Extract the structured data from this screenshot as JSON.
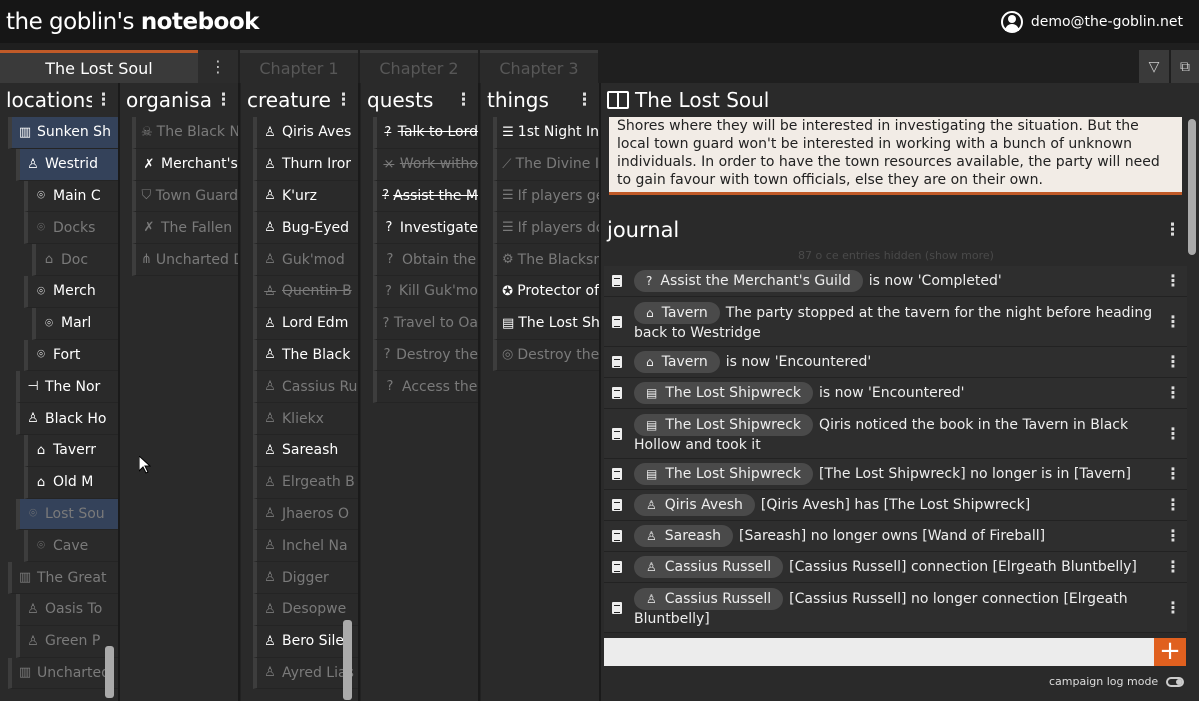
{
  "app": {
    "brand_prefix": "the goblin's ",
    "brand_bold": "notebook",
    "user_email": "demo@the-goblin.net"
  },
  "tabs": {
    "active": "The Lost Soul",
    "chapters": [
      "Chapter 1",
      "Chapter 2",
      "Chapter 3"
    ]
  },
  "columns": [
    {
      "title": "locations",
      "items": [
        {
          "label": "Sunken Sh",
          "icon": "ruins-icon",
          "style": "b hl",
          "indent": 0
        },
        {
          "label": "Westrid",
          "icon": "person-icon",
          "style": "b hl",
          "indent": 1
        },
        {
          "label": "Main C",
          "icon": "pin-icon",
          "style": "b",
          "indent": 2
        },
        {
          "label": "Docks",
          "icon": "pin-icon",
          "style": "d",
          "indent": 2
        },
        {
          "label": "Doc",
          "icon": "house-icon",
          "style": "d",
          "indent": 3
        },
        {
          "label": "Merch",
          "icon": "pin-icon",
          "style": "b",
          "indent": 2
        },
        {
          "label": "Marl",
          "icon": "pin-icon",
          "style": "b",
          "indent": 3
        },
        {
          "label": "Fort",
          "icon": "pin-icon",
          "style": "b",
          "indent": 2
        },
        {
          "label": "The Nor",
          "icon": "signpost-icon",
          "style": "b",
          "indent": 1
        },
        {
          "label": "Black Ho",
          "icon": "person-icon",
          "style": "b",
          "indent": 1
        },
        {
          "label": "Taverr",
          "icon": "house-icon",
          "style": "b",
          "indent": 2
        },
        {
          "label": "Old M",
          "icon": "house-icon",
          "style": "b",
          "indent": 2
        },
        {
          "label": "Lost Sou",
          "icon": "pin-icon",
          "style": "d hl",
          "indent": 1
        },
        {
          "label": "Cave",
          "icon": "pin-icon",
          "style": "d",
          "indent": 2
        },
        {
          "label": "The Great",
          "icon": "ruins-icon",
          "style": "d",
          "indent": 0
        },
        {
          "label": "Oasis To",
          "icon": "person-icon",
          "style": "d",
          "indent": 1
        },
        {
          "label": "Green P",
          "icon": "person-icon",
          "style": "d",
          "indent": 1
        },
        {
          "label": "Uncharted",
          "icon": "ruins-icon",
          "style": "d",
          "indent": 0
        }
      ]
    },
    {
      "title": "organisat",
      "items": [
        {
          "label": "The Black N",
          "icon": "skull-icon",
          "style": "d"
        },
        {
          "label": "Merchant's",
          "icon": "tools-icon",
          "style": "b"
        },
        {
          "label": "Town Guard",
          "icon": "shield-icon",
          "style": "d"
        },
        {
          "label": "The Fallen",
          "icon": "tools-icon",
          "style": "d"
        },
        {
          "label": "Uncharted D",
          "icon": "network-icon",
          "style": "d"
        }
      ]
    },
    {
      "title": "creatures",
      "items": [
        {
          "label": "Qiris Aves",
          "icon": "person-icon",
          "style": "b"
        },
        {
          "label": "Thurn Iror",
          "icon": "person-icon",
          "style": "b"
        },
        {
          "label": "K'urz",
          "icon": "person-icon",
          "style": "b"
        },
        {
          "label": "Bug-Eyed",
          "icon": "person-icon",
          "style": "b"
        },
        {
          "label": "Guk'mod",
          "icon": "person-icon",
          "style": "d"
        },
        {
          "label": "Quentin B",
          "icon": "person-icon",
          "style": "d s"
        },
        {
          "label": "Lord Edm",
          "icon": "person-icon",
          "style": "b"
        },
        {
          "label": "The Black",
          "icon": "person-icon",
          "style": "b"
        },
        {
          "label": "Cassius Ru",
          "icon": "person-icon",
          "style": "d"
        },
        {
          "label": "Kliekx",
          "icon": "person-icon",
          "style": "d"
        },
        {
          "label": "Sareash",
          "icon": "person-icon",
          "style": "b"
        },
        {
          "label": "Elrgeath B",
          "icon": "person-icon",
          "style": "d"
        },
        {
          "label": "Jhaeros O",
          "icon": "person-icon",
          "style": "d"
        },
        {
          "label": "Inchel Na",
          "icon": "person-icon",
          "style": "d"
        },
        {
          "label": "Digger",
          "icon": "person-icon",
          "style": "d"
        },
        {
          "label": "Desopwe",
          "icon": "person-icon",
          "style": "d"
        },
        {
          "label": "Bero Siler",
          "icon": "person-icon",
          "style": "b"
        },
        {
          "label": "Ayred Lias",
          "icon": "person-icon",
          "style": "d"
        }
      ]
    },
    {
      "title": "quests",
      "items": [
        {
          "label": "Talk to Lord",
          "icon": "question-circle-icon",
          "style": "b s"
        },
        {
          "label": "Work witho",
          "icon": "x-icon",
          "style": "d s"
        },
        {
          "label": "Assist the M",
          "icon": "question-icon",
          "style": "b s"
        },
        {
          "label": "Investigate",
          "icon": "question-icon",
          "style": "b"
        },
        {
          "label": "Obtain the",
          "icon": "question-circle-icon",
          "style": "d"
        },
        {
          "label": "Kill Guk'mo",
          "icon": "question-circle-icon",
          "style": "d"
        },
        {
          "label": "Travel to Oa",
          "icon": "question-icon",
          "style": "d"
        },
        {
          "label": "Destroy the",
          "icon": "question-icon",
          "style": "d"
        },
        {
          "label": "Access the",
          "icon": "question-icon",
          "style": "d"
        }
      ]
    },
    {
      "title": "things",
      "items": [
        {
          "label": "1st Night In",
          "icon": "list-icon",
          "style": "b"
        },
        {
          "label": "The Divine I",
          "icon": "wand-icon",
          "style": "d"
        },
        {
          "label": "If players ge",
          "icon": "list-icon",
          "style": "d"
        },
        {
          "label": "If players do",
          "icon": "list-icon",
          "style": "d"
        },
        {
          "label": "The Blacksm",
          "icon": "gear-icon",
          "style": "d"
        },
        {
          "label": "Protector of",
          "icon": "medal-icon",
          "style": "b"
        },
        {
          "label": "The Lost Sh",
          "icon": "scroll-icon",
          "style": "b"
        },
        {
          "label": "Destroy the",
          "icon": "target-icon",
          "style": "d"
        }
      ]
    }
  ],
  "detail": {
    "title": "The Lost Soul",
    "description": "Shores where they will be interested in investigating the situation. But the local town guard won't be interested in working with a bunch of unknown individuals. In order to have the town resources available, the party will need to gain favour with town officials, else they are on their own.",
    "journal_title": "journal",
    "hidden_note": "87 o ce entries hidden (show more)",
    "entries": [
      {
        "chip": "Assist the Merchant's Guild",
        "chip_icon": "question-icon",
        "text": "is now 'Completed'"
      },
      {
        "chip": "Tavern",
        "chip_icon": "house-icon",
        "text": "The party stopped at the tavern for the night before heading back to Westridge"
      },
      {
        "chip": "Tavern",
        "chip_icon": "house-icon",
        "text": "is now 'Encountered'"
      },
      {
        "chip": "The Lost Shipwreck",
        "chip_icon": "scroll-icon",
        "text": "is now 'Encountered'"
      },
      {
        "chip": "The Lost Shipwreck",
        "chip_icon": "scroll-icon",
        "text": "Qiris noticed the book in the Tavern in Black Hollow and took it"
      },
      {
        "chip": "The Lost Shipwreck",
        "chip_icon": "scroll-icon",
        "text": "[The Lost Shipwreck] no longer is in [Tavern]"
      },
      {
        "chip": "Qiris Avesh",
        "chip_icon": "person-icon",
        "text": "[Qiris Avesh] has [The Lost Shipwreck]"
      },
      {
        "chip": "Sareash",
        "chip_icon": "person-icon",
        "text": "[Sareash] no longer owns [Wand of Fireball]"
      },
      {
        "chip": "Cassius Russell",
        "chip_icon": "person-icon",
        "text": "[Cassius Russell] connection [Elrgeath Bluntbelly]"
      },
      {
        "chip": "Cassius Russell",
        "chip_icon": "person-icon",
        "text": "[Cassius Russell] no longer connection [Elrgeath Bluntbelly]"
      }
    ],
    "add_label": "+",
    "log_mode_label": "campaign log mode"
  }
}
